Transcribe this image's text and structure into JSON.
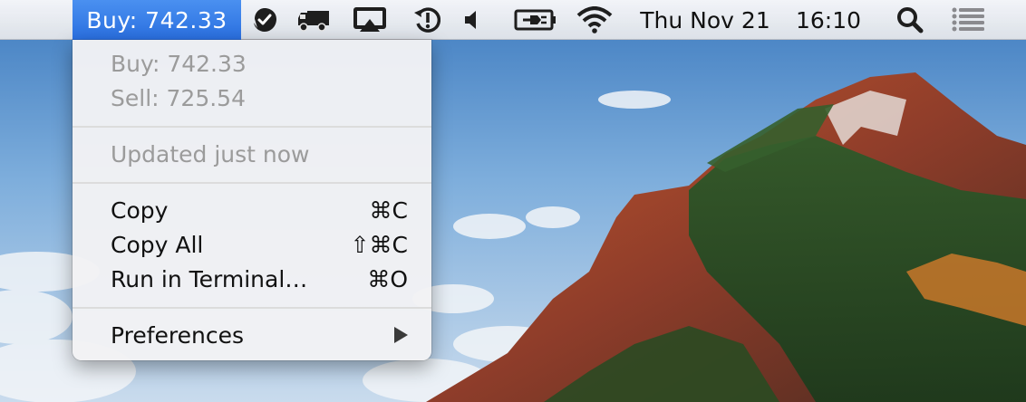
{
  "menubar": {
    "active_item": "Buy: 742.33",
    "date": "Thu Nov 21",
    "time": "16:10",
    "icons": [
      "checkmark-badge-icon",
      "delivery-truck-icon",
      "airplay-icon",
      "time-machine-icon",
      "volume-icon",
      "battery-charging-icon",
      "wifi-icon",
      "spotlight-search-icon",
      "notification-center-icon"
    ]
  },
  "menu": {
    "info": {
      "buy": "Buy: 742.33",
      "sell": "Sell: 725.54",
      "updated": "Updated just now"
    },
    "actions": [
      {
        "label": "Copy",
        "shortcut": "⌘C"
      },
      {
        "label": "Copy All",
        "shortcut": "⇧⌘C"
      },
      {
        "label": "Run in Terminal…",
        "shortcut": "⌘O"
      }
    ],
    "preferences": {
      "label": "Preferences",
      "icon": "submenu-arrow-icon"
    }
  },
  "colors": {
    "highlight": "#2a6fe0",
    "disabled_text": "#9b9b9b"
  }
}
